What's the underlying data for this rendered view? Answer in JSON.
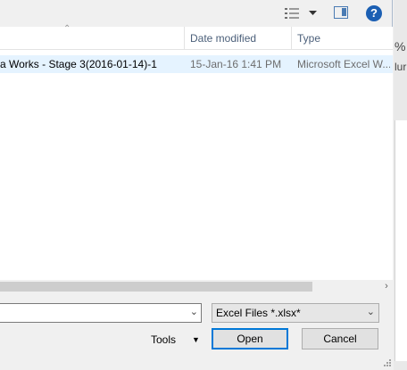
{
  "toolbar": {
    "view_icon": "details-view-icon",
    "pane_icon": "preview-pane-icon",
    "help_label": "?"
  },
  "background": {
    "peek_1": "%",
    "peek_2": "lur"
  },
  "filelist": {
    "columns": [
      {
        "label": ""
      },
      {
        "label": "Date modified"
      },
      {
        "label": "Type"
      }
    ],
    "rows": [
      {
        "name": "a Works - Stage 3(2016-01-14)-1",
        "date": "15-Jan-16 1:41 PM",
        "type": "Microsoft Excel W..."
      }
    ]
  },
  "bottom": {
    "filename_value": "",
    "filetype_selected": "Excel Files *.xlsx*",
    "tools_label": "Tools",
    "open_label": "Open",
    "cancel_label": "Cancel"
  },
  "colors": {
    "selection": "#e5f3ff",
    "accent": "#0078d7",
    "help": "#1b5fb3"
  }
}
